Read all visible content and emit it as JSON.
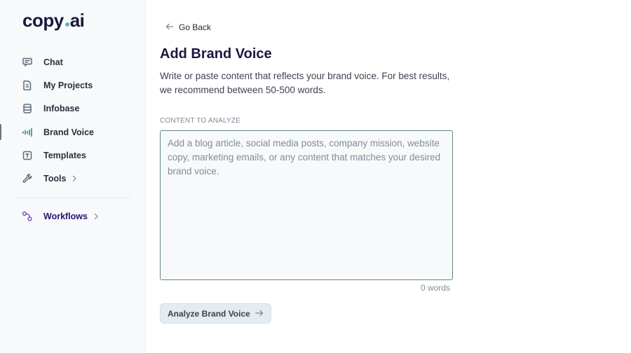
{
  "brand": {
    "name_part1": "copy",
    "name_part2": "ai",
    "dot_color": "#4fc0b8"
  },
  "sidebar": {
    "items": [
      {
        "label": "Chat",
        "icon": "chat-icon",
        "active": false
      },
      {
        "label": "My Projects",
        "icon": "file-icon",
        "active": false
      },
      {
        "label": "Infobase",
        "icon": "database-icon",
        "active": false
      },
      {
        "label": "Brand Voice",
        "icon": "soundwave-icon",
        "active": true
      },
      {
        "label": "Templates",
        "icon": "template-icon",
        "active": false
      },
      {
        "label": "Tools",
        "icon": "wrench-icon",
        "active": false,
        "has_chevron": true
      }
    ],
    "workflows": {
      "label": "Workflows",
      "icon": "workflow-icon",
      "has_chevron": true,
      "color": "#2a1470"
    }
  },
  "main": {
    "go_back_label": "Go Back",
    "title": "Add Brand Voice",
    "description": "Write or paste content that reflects your brand voice. For best results, we recommend between 50-500 words.",
    "field_label": "CONTENT TO ANALYZE",
    "content_value": "",
    "content_placeholder": "Add a blog article, social media posts, company mission, website copy, marketing emails, or any content that matches your desired brand voice.",
    "word_count": "0 words",
    "analyze_button_label": "Analyze Brand Voice"
  },
  "colors": {
    "accent_teal": "#2f8f86",
    "title_navy": "#1a1840",
    "input_border": "#5f8686"
  }
}
